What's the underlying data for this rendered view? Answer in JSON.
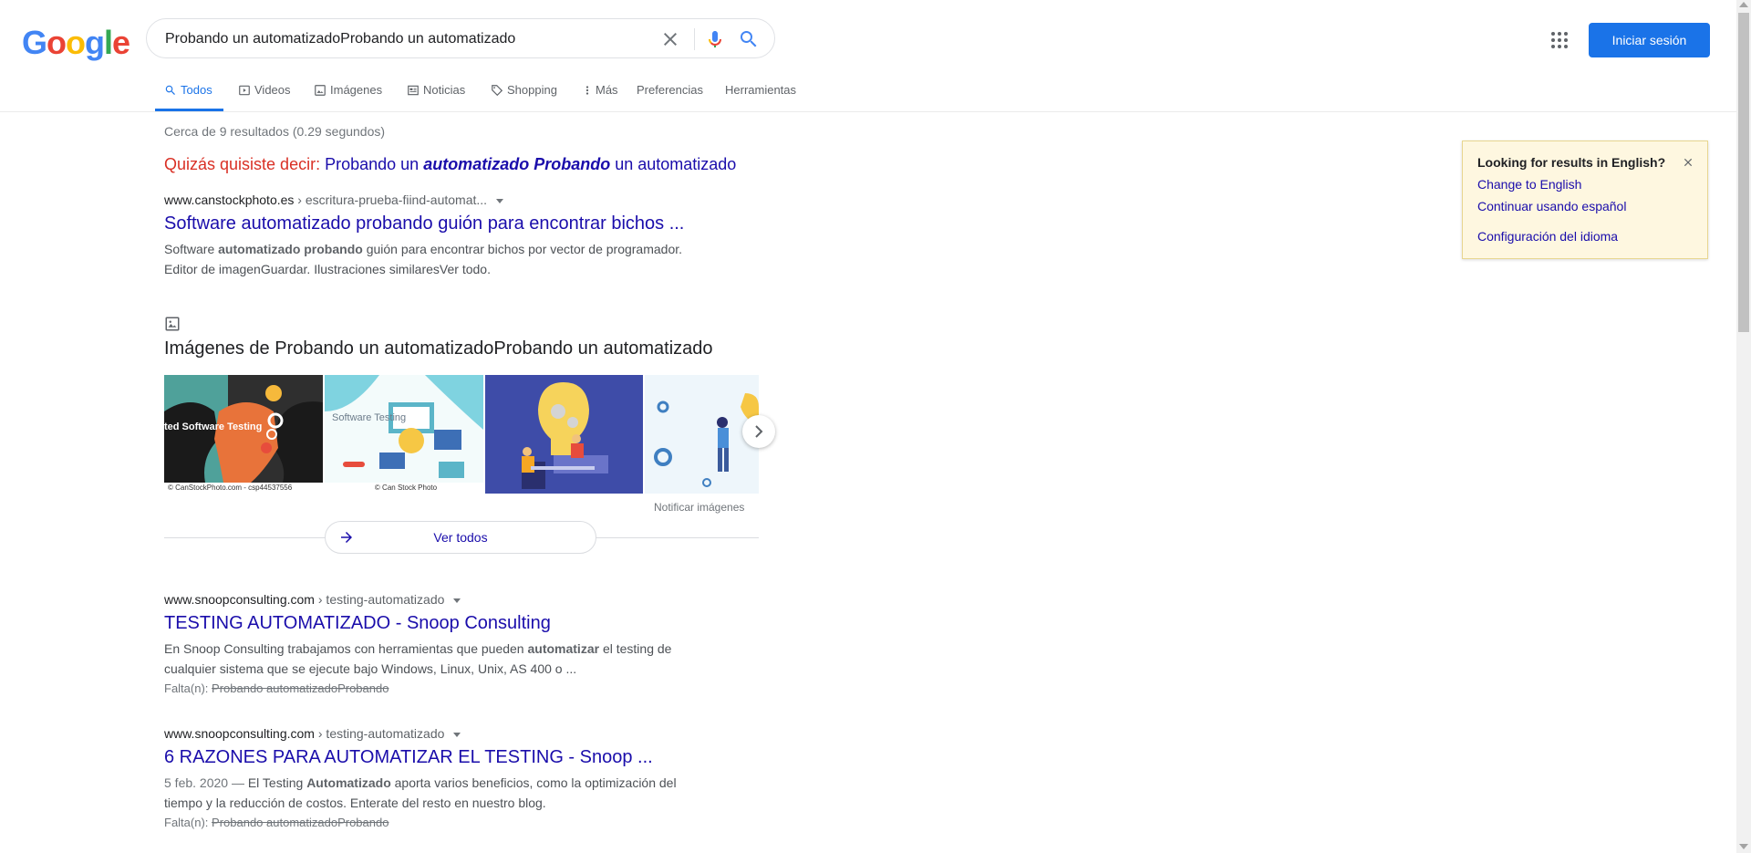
{
  "logo": {
    "letters": [
      "G",
      "o",
      "o",
      "g",
      "l",
      "e"
    ],
    "colors": [
      "#4285f4",
      "#ea4335",
      "#fbbc05",
      "#4285f4",
      "#34a853",
      "#ea4335"
    ]
  },
  "search": {
    "value": "Probando un automatizadoProbando un automatizado"
  },
  "header": {
    "signin_label": "Iniciar sesión"
  },
  "tabs": [
    {
      "label": "Todos",
      "icon": "search-icon",
      "active": true
    },
    {
      "label": "Videos",
      "icon": "video-icon"
    },
    {
      "label": "Imágenes",
      "icon": "image-icon"
    },
    {
      "label": "Noticias",
      "icon": "news-icon"
    },
    {
      "label": "Shopping",
      "icon": "tag-icon"
    },
    {
      "label": "Más",
      "icon": "more-vert-icon"
    },
    {
      "label": "Preferencias"
    },
    {
      "label": "Herramientas"
    }
  ],
  "stats": "Cerca de 9 resultados (0.29 segundos)",
  "did_you_mean": {
    "label": "Quizás quisiste decir:",
    "parts": [
      "Probando un ",
      "automatizado Probando",
      " un automatizado"
    ]
  },
  "results": [
    {
      "domain": "www.canstockphoto.es",
      "path": " › escritura-prueba-fiind-automat...",
      "title": "Software automatizado probando guión para encontrar bichos ...",
      "snippet_parts": [
        "Software ",
        "automatizado probando",
        " guión para encontrar bichos por vector de programador. Editor de imagenGuardar. Ilustraciones similaresVer todo."
      ]
    },
    {
      "domain": "www.snoopconsulting.com",
      "path": " › testing-automatizado",
      "title": "TESTING AUTOMATIZADO - Snoop Consulting",
      "snippet_parts": [
        "En Snoop Consulting trabajamos con herramientas que pueden ",
        "automatizar",
        " el testing de cualquier sistema que se ejecute bajo Windows, Linux, Unix, AS 400 o ..."
      ],
      "missing_label": "Falta(n):",
      "missing_terms": "Probando automatizadoProbando"
    },
    {
      "domain": "www.snoopconsulting.com",
      "path": " › testing-automatizado",
      "title": "6 RAZONES PARA AUTOMATIZAR EL TESTING - Snoop ...",
      "date": "5 feb. 2020 — ",
      "snippet_parts": [
        "El Testing ",
        "Automatizado",
        " aporta varios beneficios, como la optimización del tiempo y la reducción de costos. Enterate del resto en nuestro blog."
      ],
      "missing_label": "Falta(n):",
      "missing_terms": "Probando automatizadoProbando"
    }
  ],
  "images_block": {
    "heading": "Imágenes de Probando un automatizadoProbando un automatizado",
    "thumb1_caption": "© CanStockPhoto.com - csp44537556",
    "thumb1_overlay": "ted Software Testing",
    "thumb2_caption": "© Can Stock Photo",
    "thumb2_text": "Software Testing",
    "report": "Notificar imágenes",
    "view_all": "Ver todos"
  },
  "lang_panel": {
    "title": "Looking for results in English?",
    "links": [
      "Change to English",
      "Continuar usando español",
      "Configuración del idioma"
    ]
  }
}
